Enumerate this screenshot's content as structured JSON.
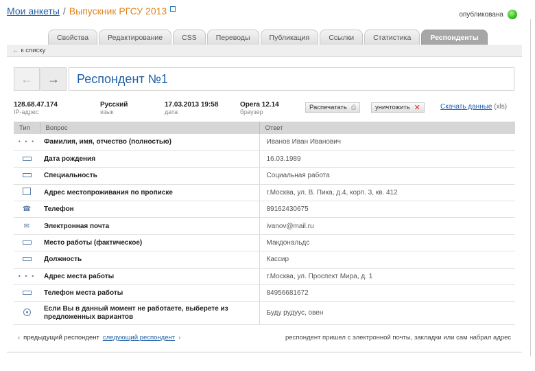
{
  "breadcrumbs": {
    "root": "Мои анкеты",
    "separator": "/",
    "current": "Выпускник РГСУ 2013"
  },
  "publication_status": {
    "label": "опубликована",
    "color": "#2fb51b"
  },
  "tabs": [
    {
      "label": "Свойства",
      "active": false
    },
    {
      "label": "Редактирование",
      "active": false
    },
    {
      "label": "CSS",
      "active": false
    },
    {
      "label": "Переводы",
      "active": false
    },
    {
      "label": "Публикация",
      "active": false
    },
    {
      "label": "Ссылки",
      "active": false
    },
    {
      "label": "Статистика",
      "active": false
    },
    {
      "label": "Респонденты",
      "active": true
    }
  ],
  "back_link": "к списку",
  "respondent_title": "Респондент №1",
  "meta": {
    "ip": {
      "value": "128.68.47.174",
      "label": "IP-адрес"
    },
    "language": {
      "value": "Русский",
      "label": "язык"
    },
    "date": {
      "value": "17.03.2013 19:58",
      "label": "дата"
    },
    "browser": {
      "value": "Opera 12.14",
      "label": "браузер"
    }
  },
  "actions": {
    "print": "Распечатать",
    "delete": "уничтожить",
    "download_link": "Скачать данные",
    "download_suffix": "(xls)"
  },
  "table": {
    "headers": {
      "type": "Тип",
      "question": "Вопрос",
      "answer": "Ответ"
    },
    "rows": [
      {
        "icon": "dots",
        "question": "Фамилия, имя, отчество (полностью)",
        "answer": "Иванов Иван Иванович"
      },
      {
        "icon": "input",
        "question": "Дата рождения",
        "answer": "16.03.1989"
      },
      {
        "icon": "input",
        "question": "Специальность",
        "answer": "Социальная работа"
      },
      {
        "icon": "textarea",
        "question": "Адрес местопроживания по прописке",
        "answer": "г.Москва, ул. В. Пика, д.4, корп. 3, кв. 412"
      },
      {
        "icon": "phone",
        "question": "Телефон",
        "answer": "89162430675"
      },
      {
        "icon": "email",
        "question": "Электронная почта",
        "answer": "ivanov@mail.ru"
      },
      {
        "icon": "input",
        "question": "Место работы (фактическое)",
        "answer": "Макдональдс"
      },
      {
        "icon": "input",
        "question": "Должность",
        "answer": "Кассир"
      },
      {
        "icon": "dots",
        "question": "Адрес места работы",
        "answer": "г.Москва, ул. Проспект Мира, д. 1"
      },
      {
        "icon": "input",
        "question": "Телефон места работы",
        "answer": "84956681672"
      },
      {
        "icon": "radio",
        "question": "Если Вы в данный момент не работаете, выберете из предложенных вариантов",
        "answer": "Буду рудуус, овен"
      }
    ]
  },
  "footer": {
    "prev_label": "предыдущий респондент",
    "next_label": "следующий респондент",
    "note": "респондент пришел с электронной почты, закладки или сам набрал адрес"
  }
}
